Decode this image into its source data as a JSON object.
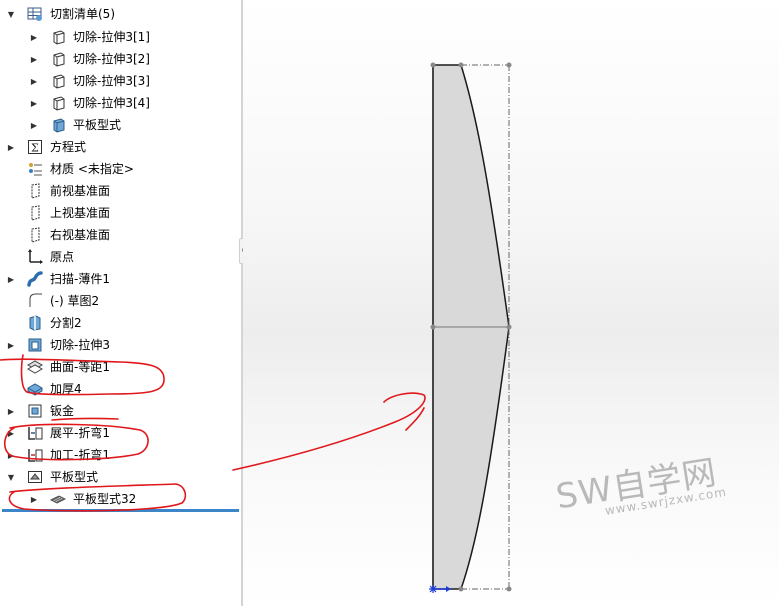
{
  "tree": {
    "items": [
      {
        "label": "切割清单(5)",
        "icon": "cut-list-folder-icon",
        "expander": "expanded"
      },
      {
        "label": "切除-拉伸3[1]",
        "icon": "solid-body-icon",
        "expander": "collapsed"
      },
      {
        "label": "切除-拉伸3[2]",
        "icon": "solid-body-icon",
        "expander": "collapsed"
      },
      {
        "label": "切除-拉伸3[3]",
        "icon": "solid-body-icon",
        "expander": "collapsed"
      },
      {
        "label": "切除-拉伸3[4]",
        "icon": "solid-body-icon",
        "expander": "collapsed"
      },
      {
        "label": "平板型式",
        "icon": "sheet-metal-body-icon",
        "expander": "collapsed"
      },
      {
        "label": "方程式",
        "icon": "equations-icon",
        "expander": "collapsed"
      },
      {
        "label": "材质 <未指定>",
        "icon": "material-icon",
        "expander": "none"
      },
      {
        "label": "前视基准面",
        "icon": "plane-icon",
        "expander": "none"
      },
      {
        "label": "上视基准面",
        "icon": "plane-icon",
        "expander": "none"
      },
      {
        "label": "右视基准面",
        "icon": "plane-icon",
        "expander": "none"
      },
      {
        "label": "原点",
        "icon": "origin-icon",
        "expander": "none"
      },
      {
        "label": "扫描-薄件1",
        "icon": "sweep-icon",
        "expander": "collapsed"
      },
      {
        "label": "(-) 草图2",
        "icon": "sketch-icon",
        "expander": "none"
      },
      {
        "label": "分割2",
        "icon": "split-icon",
        "expander": "none"
      },
      {
        "label": "切除-拉伸3",
        "icon": "cut-extrude-icon",
        "expander": "collapsed"
      },
      {
        "label": "曲面-等距1",
        "icon": "offset-surface-icon",
        "expander": "none"
      },
      {
        "label": "加厚4",
        "icon": "thicken-icon",
        "expander": "none"
      },
      {
        "label": "钣金",
        "icon": "sheet-metal-icon",
        "expander": "collapsed"
      },
      {
        "label": "展平-折弯1",
        "icon": "flatten-bends-icon",
        "expander": "collapsed"
      },
      {
        "label": "加工-折弯1",
        "icon": "process-bends-icon",
        "expander": "collapsed"
      },
      {
        "label": "平板型式",
        "icon": "flat-pattern-folder-icon",
        "expander": "expanded"
      },
      {
        "label": "平板型式32",
        "icon": "flat-pattern-icon",
        "expander": "collapsed"
      }
    ]
  },
  "watermark": {
    "main": "SW自学网",
    "sub": "www.swrjzxw.com"
  },
  "colors": {
    "annotation_red": "#e0181c",
    "rollback_bar": "#3a86c8",
    "part_fill": "#d9d9d9"
  }
}
